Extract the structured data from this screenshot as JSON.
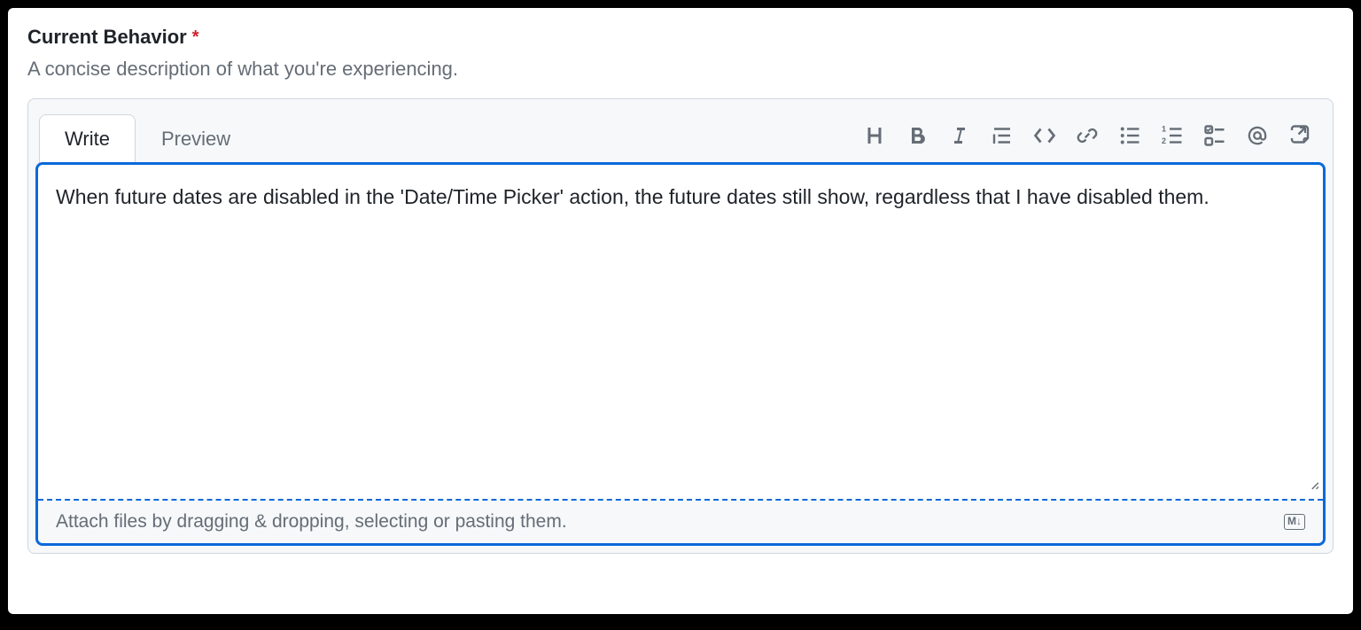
{
  "field": {
    "label": "Current Behavior",
    "required_marker": "*",
    "description": "A concise description of what you're experiencing."
  },
  "tabs": {
    "write": "Write",
    "preview": "Preview"
  },
  "toolbar_icons": {
    "heading": "heading-icon",
    "bold": "bold-icon",
    "italic": "italic-icon",
    "quote": "quote-icon",
    "code": "code-icon",
    "link": "link-icon",
    "ul": "unordered-list-icon",
    "ol": "ordered-list-icon",
    "tasklist": "task-list-icon",
    "mention": "mention-icon",
    "reference": "cross-reference-icon"
  },
  "editor": {
    "value": "When future dates are disabled in the 'Date/Time Picker' action, the future dates still show, regardless that I have disabled them."
  },
  "attach": {
    "hint": "Attach files by dragging & dropping, selecting or pasting them.",
    "markdown_badge": "M↓"
  }
}
